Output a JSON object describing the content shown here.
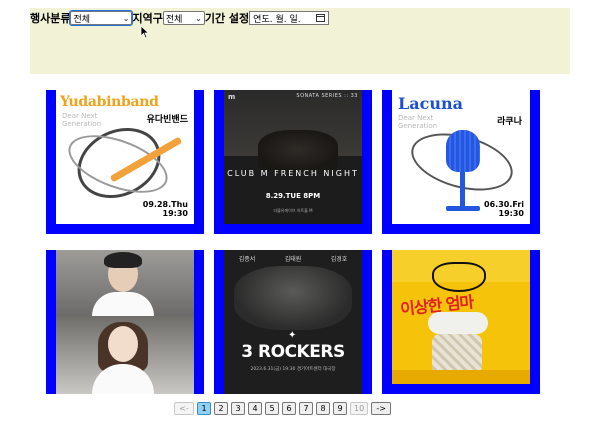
{
  "filters": {
    "category_label": "행사분류",
    "category_value": "전체",
    "region_label": "지역구",
    "region_value": "전체",
    "period_label": "기간 설정",
    "date_placeholder": "연도. 월. 일."
  },
  "posters": [
    {
      "title": "Yudabinband",
      "subtitle": "Dear Next Generation",
      "korean_title": "유다빈밴드",
      "date": "09.28.Thu",
      "time": "19:30"
    },
    {
      "brand": "m",
      "series": "SONATA SERIES :: 33",
      "title": "CLUB M FRENCH NIGHT",
      "date": "8.29.TUE 8PM",
      "venue": "더블유에이브 아트홀 M"
    },
    {
      "title": "Lacuna",
      "subtitle": "Dear Next Generation",
      "korean_title": "라쿠나",
      "date": "06.30.Fri",
      "time": "19:30"
    },
    {
      "type": "photo"
    },
    {
      "names": [
        "김종서",
        "김태원",
        "김경호"
      ],
      "title": "3 ROCKERS",
      "info": "2023.6.31(금) 19:30 경기아트센터 대극장"
    },
    {
      "title": "이상한 엄마"
    }
  ],
  "pagination": {
    "prev": "<-",
    "pages": [
      "1",
      "2",
      "3",
      "4",
      "5",
      "6",
      "7",
      "8",
      "9",
      "10"
    ],
    "active": "1",
    "next": "->"
  }
}
